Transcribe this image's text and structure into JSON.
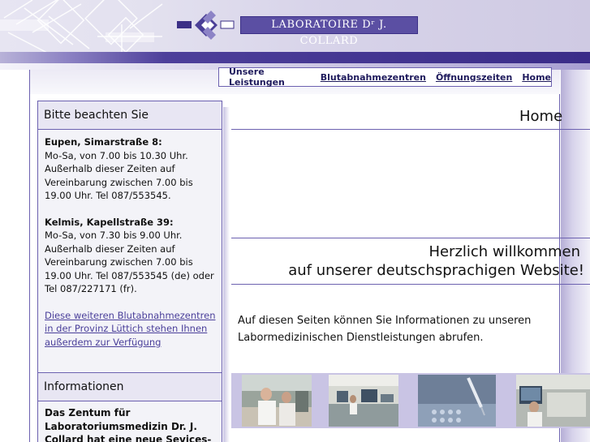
{
  "header": {
    "logo_text": "LABORATOIRE Dʳ J. COLLARD"
  },
  "nav": {
    "items": [
      {
        "label": "Unsere Leistungen"
      },
      {
        "label": "Blutabnahmezentren"
      },
      {
        "label": "Öffnungszeiten"
      },
      {
        "label": "Home"
      }
    ]
  },
  "sidebar": {
    "notice": {
      "heading": "Bitte beachten Sie",
      "loc1_title": "Eupen, Simarstraße 8:",
      "loc1_text": "Mo-Sa, von 7.00 bis 10.30 Uhr. Außerhalb dieser Zeiten auf Vereinbarung zwischen 7.00 bis 19.00 Uhr. Tel 087/553545.",
      "loc2_title": "Kelmis, Kapellstraße 39:",
      "loc2_text": "Mo-Sa, von 7.30 bis 9.00 Uhr. Außerhalb dieser Zeiten auf Vereinbarung zwischen 7.00 bis 19.00 Uhr. Tel 087/553545 (de) oder Tel 087/227171 (fr).",
      "link_text": "Diese weiteren Blutabnahmezentren in der Provinz Lüttich stehen Ihnen außerdem zur Verfügung"
    },
    "info": {
      "heading": "Informationen",
      "text": "Das Zentum für Laboratoriumsmedizin Dr. J. Collard hat eine neue Sevices-"
    }
  },
  "main": {
    "page_title": "Home",
    "welcome_line1": "Herzlich willkommen",
    "welcome_line2": "auf unserer deutschsprachigen Website!",
    "intro": "Auf diesen Seiten können Sie Informationen zu unseren Labormedizinischen Dienstleistungen abrufen."
  },
  "photos": [
    {
      "subject": "lab-staff-photo"
    },
    {
      "subject": "lab-room-photo"
    },
    {
      "subject": "pipette-photo"
    },
    {
      "subject": "analyzer-photo"
    }
  ],
  "colors": {
    "brand": "#5b4fa3",
    "border": "#6c61b0",
    "band": "#3a2c88",
    "link": "#4a3f9a"
  }
}
